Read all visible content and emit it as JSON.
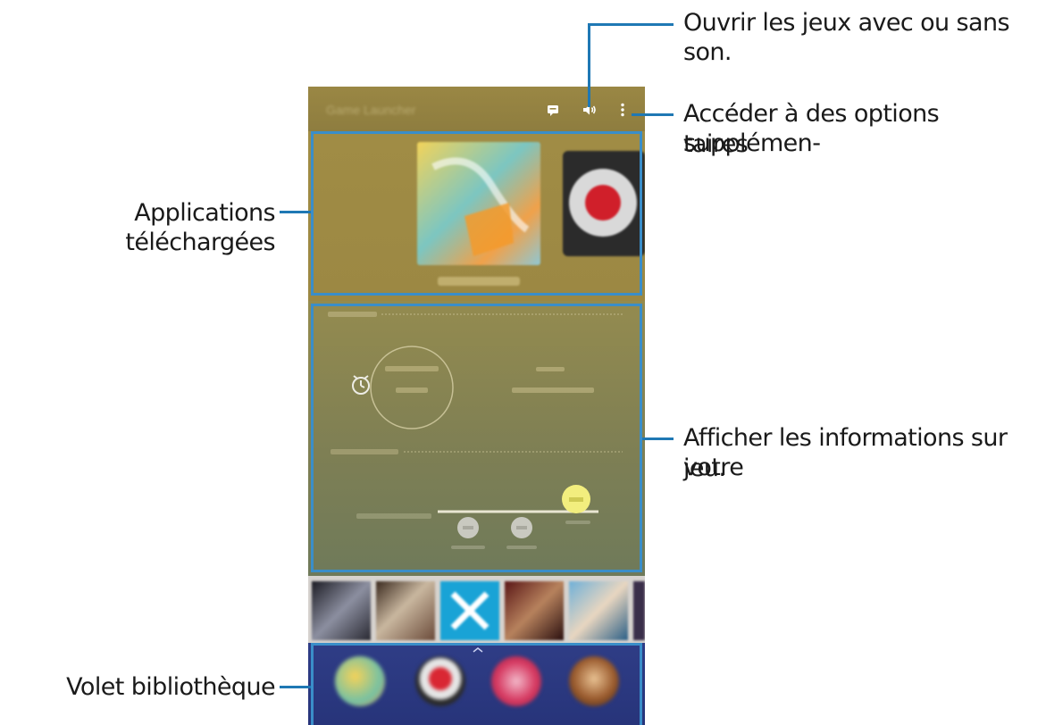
{
  "callouts": {
    "sound": "Ouvrir les jeux avec ou sans son.",
    "options_line1": "Accéder à des options supplémen-",
    "options_line2": "taires",
    "downloaded": "Applications téléchargées",
    "info_line1": "Afficher les informations sur votre",
    "info_line2": "jeu.",
    "library": "Volet bibliothèque"
  },
  "appbar": {
    "title": "Game Launcher",
    "icons": [
      "message-icon",
      "sound-icon",
      "more-options-icon"
    ]
  },
  "colors": {
    "callout_line": "#1f78b4",
    "highlight_border": "#3a8ec9",
    "appbar": "#9a8744",
    "library_bg": "#2f3d86"
  }
}
